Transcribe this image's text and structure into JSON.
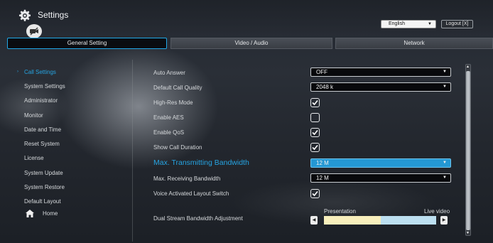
{
  "header": {
    "title": "Settings",
    "language": "English",
    "logout_label": "Logout [X]"
  },
  "tabs": [
    {
      "label": "General Setting",
      "active": true
    },
    {
      "label": "Video / Audio",
      "active": false
    },
    {
      "label": "Network",
      "active": false
    }
  ],
  "sidebar": {
    "items": [
      {
        "label": "Call Settings",
        "active": true
      },
      {
        "label": "System Settings"
      },
      {
        "label": "Administrator"
      },
      {
        "label": "Monitor"
      },
      {
        "label": "Date and Time"
      },
      {
        "label": "Reset System"
      },
      {
        "label": "License"
      },
      {
        "label": "System Update"
      },
      {
        "label": "System Restore"
      },
      {
        "label": "Default Layout"
      }
    ],
    "home_label": "Home"
  },
  "settings": {
    "auto_answer": {
      "label": "Auto Answer",
      "value": "OFF"
    },
    "default_call_quality": {
      "label": "Default Call Quality",
      "value": "2048 k"
    },
    "high_res_mode": {
      "label": "High-Res Mode",
      "checked": true
    },
    "enable_aes": {
      "label": "Enable AES",
      "checked": false
    },
    "enable_qos": {
      "label": "Enable QoS",
      "checked": true
    },
    "show_call_duration": {
      "label": "Show Call Duration",
      "checked": true
    },
    "max_tx_bandwidth": {
      "label": "Max. Transmitting Bandwidth",
      "value": "12 M"
    },
    "max_rx_bandwidth": {
      "label": "Max. Receiving Bandwidth",
      "value": "12 M"
    },
    "voice_activated_layout": {
      "label": "Voice Activated Layout Switch",
      "checked": true
    },
    "dual_stream": {
      "label": "Dual Stream Bandwidth Adjustment",
      "left_label": "Presentation",
      "right_label": "Live video",
      "presentation_fraction": 0.5
    }
  },
  "colors": {
    "accent": "#26a4e2",
    "highlight_select": "#2498d4",
    "presentation_bar": "#f8efbc",
    "live_video_bar": "#bcdff0"
  }
}
